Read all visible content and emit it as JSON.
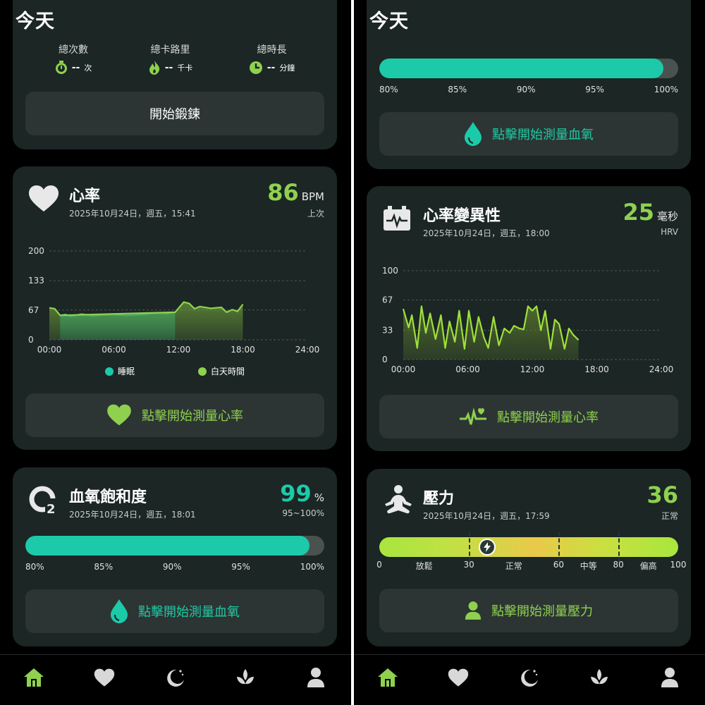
{
  "header": {
    "title": "今天"
  },
  "colors": {
    "accent_green": "#8fd14f",
    "accent_teal": "#1ccaa9",
    "card_bg": "#1b2625",
    "button_bg": "#2c3533"
  },
  "workout": {
    "stats": [
      {
        "label": "總次數",
        "value": "--",
        "unit": "次",
        "icon": "stopwatch-icon"
      },
      {
        "label": "總卡路里",
        "value": "--",
        "unit": "千卡",
        "icon": "flame-icon"
      },
      {
        "label": "總時長",
        "value": "--",
        "unit": "分鐘",
        "icon": "clock-icon"
      }
    ],
    "start_button": "開始鍛鍊"
  },
  "heart_rate": {
    "title": "心率",
    "datetime": "2025年10月24日，週五，15:41",
    "value": "86",
    "unit": "BPM",
    "sub_label": "上次",
    "legend": [
      {
        "label": "睡眠",
        "color": "#1ccaa9"
      },
      {
        "label": "白天時間",
        "color": "#8fd14f"
      }
    ],
    "measure_button": "點擊開始測量心率"
  },
  "spo2": {
    "title": "血氧飽和度",
    "datetime": "2025年10月24日，週五，18:01",
    "value": "99",
    "unit": "%",
    "range": "95~100%",
    "bar_ticks": [
      "80%",
      "85%",
      "90%",
      "95%",
      "100%"
    ],
    "bar_percent": 99,
    "measure_button": "點擊開始測量血氧"
  },
  "hrv": {
    "title": "心率變異性",
    "datetime": "2025年10月24日，週五，18:00",
    "value": "25",
    "unit": "毫秒",
    "sub_label": "HRV",
    "measure_button": "點擊開始測量心率"
  },
  "stress": {
    "title": "壓力",
    "datetime": "2025年10月24日，週五，17:59",
    "value": "36",
    "sub_label": "正常",
    "scale_numbers": [
      "0",
      "30",
      "60",
      "80",
      "100"
    ],
    "zone_labels": [
      "放鬆",
      "正常",
      "中等",
      "偏高"
    ],
    "level": 36,
    "measure_button": "點擊開始測量壓力"
  },
  "tabs": [
    {
      "name": "home",
      "icon": "home-icon",
      "active": true
    },
    {
      "name": "health",
      "icon": "heart-icon",
      "active": false
    },
    {
      "name": "sleep",
      "icon": "moon-icon",
      "active": false
    },
    {
      "name": "mindfulness",
      "icon": "lotus-icon",
      "active": false
    },
    {
      "name": "profile",
      "icon": "person-icon",
      "active": false
    }
  ],
  "chart_data": [
    {
      "type": "area",
      "title": "心率",
      "x_ticks": [
        "00:00",
        "06:00",
        "12:00",
        "18:00",
        "24:00"
      ],
      "y_ticks": [
        "0",
        "67",
        "133",
        "200"
      ],
      "xlim": [
        0,
        24
      ],
      "ylim": [
        0,
        200
      ],
      "series": [
        {
          "name": "睡眠",
          "x": [
            1.0,
            1.5,
            2.0,
            3.0,
            4.0,
            5.0,
            6.0,
            7.0,
            8.0,
            9.0,
            10.0,
            11.0,
            11.7
          ],
          "y": [
            55,
            57,
            53,
            58,
            54,
            56,
            57,
            55,
            56,
            58,
            60,
            59,
            62
          ]
        },
        {
          "name": "白天時間",
          "x": [
            0.0,
            0.5,
            1.0,
            11.7,
            12.5,
            13.0,
            13.5,
            14.0,
            15.0,
            16.0,
            16.5,
            17.0,
            17.5,
            18.0
          ],
          "y": [
            72,
            70,
            55,
            62,
            85,
            82,
            70,
            75,
            71,
            73,
            62,
            68,
            64,
            80
          ]
        }
      ]
    },
    {
      "type": "area",
      "title": "心率變異性",
      "x_ticks": [
        "00:00",
        "06:00",
        "12:00",
        "18:00",
        "24:00"
      ],
      "y_ticks": [
        "0",
        "33",
        "67",
        "100"
      ],
      "xlim": [
        0,
        24
      ],
      "ylim": [
        0,
        100
      ],
      "series": [
        {
          "name": "HRV",
          "x": [
            0.0,
            0.5,
            0.8,
            1.3,
            1.7,
            2.1,
            2.5,
            3.0,
            3.5,
            3.9,
            4.3,
            4.8,
            5.2,
            5.7,
            6.1,
            6.6,
            7.0,
            7.5,
            7.9,
            8.4,
            8.9,
            9.4,
            9.9,
            10.3,
            10.8,
            11.2,
            11.6,
            12.0,
            12.4,
            12.8,
            13.2,
            13.7,
            14.1,
            14.5,
            15.0,
            15.4,
            15.8,
            16.3
          ],
          "y": [
            57,
            36,
            50,
            13,
            60,
            30,
            52,
            23,
            50,
            13,
            43,
            20,
            55,
            12,
            55,
            20,
            48,
            25,
            13,
            48,
            16,
            35,
            30,
            38,
            35,
            34,
            60,
            55,
            60,
            33,
            55,
            12,
            45,
            40,
            12,
            35,
            28,
            22
          ]
        }
      ]
    }
  ]
}
